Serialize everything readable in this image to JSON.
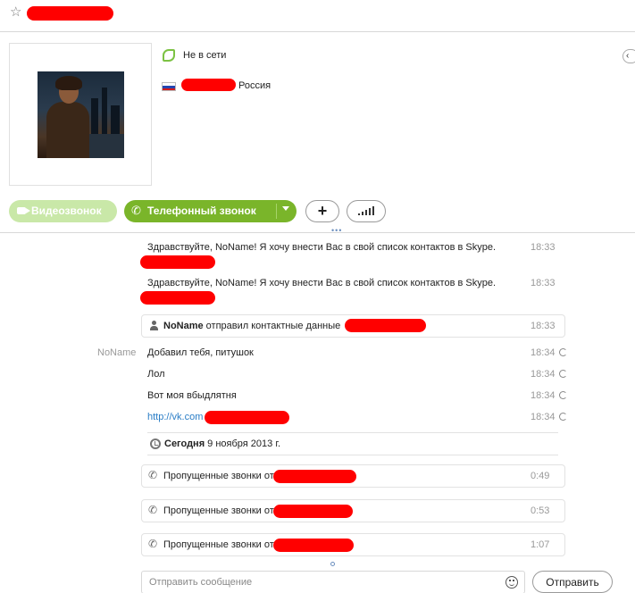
{
  "header": {
    "star_icon": "star-outline-icon"
  },
  "profile": {
    "status": "Не в сети",
    "country": "Россия",
    "collapse_glyph": "‹"
  },
  "actions": {
    "video_label": "Видеозвонок",
    "call_label": "Телефонный звонок",
    "add_glyph": "+",
    "dots": "•••"
  },
  "messages": [
    {
      "text": "Здравствуйте, NoName! Я хочу внести Вас в свой список контактов в Skype.",
      "time": "18:33"
    },
    {
      "text": "Здравствуйте, NoName! Я хочу внести Вас в свой список контактов в Skype.",
      "time": "18:33"
    }
  ],
  "contact_share": {
    "name": "NoName",
    "text": " отправил контактные данные",
    "time": "18:33"
  },
  "chat": {
    "sender": "NoName",
    "items": [
      {
        "text": "Добавил тебя, питушок",
        "time": "18:34"
      },
      {
        "text": "Лол",
        "time": "18:34"
      },
      {
        "text": "Вот моя вбыдлятня",
        "time": "18:34"
      },
      {
        "text": "http://vk.com",
        "time": "18:34"
      }
    ]
  },
  "date_divider": {
    "bold": "Сегодня",
    "rest": " 9 ноября 2013 г."
  },
  "missed_calls": [
    {
      "text": "Пропущенные звонки от",
      "duration": "0:49"
    },
    {
      "text": "Пропущенные звонки от",
      "duration": "0:53"
    },
    {
      "text": "Пропущенные звонки от",
      "duration": "1:07"
    }
  ],
  "compose": {
    "placeholder": "Отправить сообщение",
    "send_label": "Отправить"
  },
  "colors": {
    "accent_green": "#7ab52a",
    "disabled_green": "#c9e8a8",
    "redaction": "#ff0000",
    "link": "#2a7dc6"
  }
}
